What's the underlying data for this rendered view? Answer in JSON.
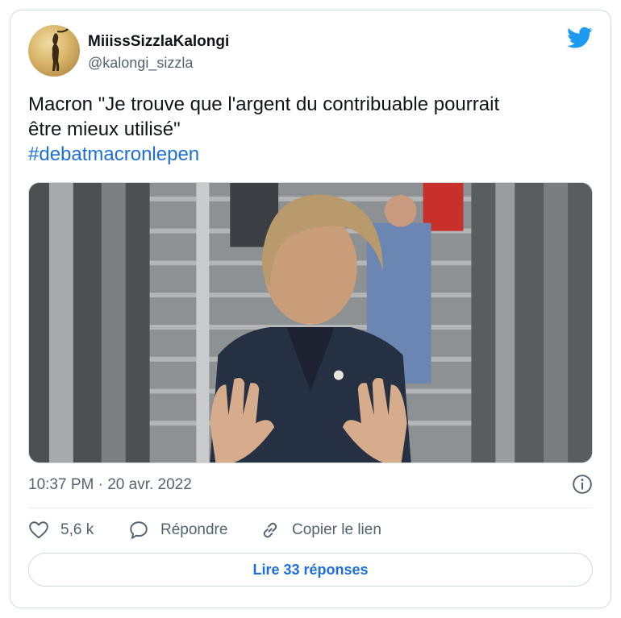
{
  "tweet": {
    "display_name": "MiiissSizzlaKalongi",
    "handle": "@kalongi_sizzla",
    "text_line1": "Macron \"Je trouve que l'argent du contribuable pourrait",
    "text_line2": "être mieux utilisé\"",
    "hashtag": "#debatmacronlepen",
    "timestamp": "10:37 PM · 20 avr. 2022",
    "media_alt": "photo"
  },
  "actions": {
    "likes_count": "5,6 k",
    "reply_label": "Répondre",
    "copy_label": "Copier le lien"
  },
  "replies_button": "Lire 33 réponses",
  "icons": {
    "brand": "twitter-bird-icon",
    "info": "info-icon",
    "like": "heart-icon",
    "reply": "reply-icon",
    "copy": "link-icon"
  },
  "colors": {
    "brand_blue": "#1d9bf0",
    "link_blue": "#1d6fd8",
    "secondary_text": "#536471",
    "border": "#cfd9de"
  }
}
